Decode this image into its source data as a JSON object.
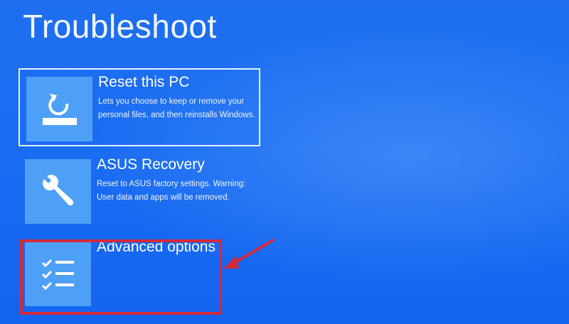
{
  "page": {
    "title": "Troubleshoot"
  },
  "options": [
    {
      "title": "Reset this PC",
      "description": "Lets you choose to keep or remove your personal files, and then reinstalls Windows.",
      "icon": "reset-pc-icon"
    },
    {
      "title": "ASUS Recovery",
      "description": "Reset to ASUS factory settings. Warning: User data and apps will be removed.",
      "icon": "wrench-icon"
    },
    {
      "title": "Advanced options",
      "description": "",
      "icon": "checklist-icon"
    }
  ],
  "colors": {
    "background": "#1a6cf2",
    "tile_icon_bg": "#4ea0f6",
    "annotation_red": "#d42a3a"
  }
}
